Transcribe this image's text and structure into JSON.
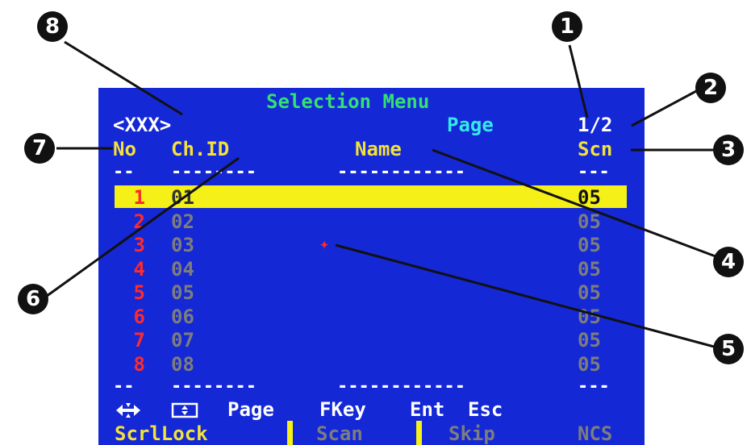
{
  "header": {
    "title": "Selection Menu",
    "group": "<XXX>",
    "page_label": "Page",
    "page_value": "1/2"
  },
  "columns": {
    "no": "No",
    "chid": "Ch.ID",
    "name": "Name",
    "scn": "Scn"
  },
  "dashes": {
    "no": "--",
    "chid": "--------",
    "name": "------------",
    "scn": "---"
  },
  "rows": [
    {
      "no": "1",
      "chid": "01",
      "scn": "05"
    },
    {
      "no": "2",
      "chid": "02",
      "scn": "05"
    },
    {
      "no": "3",
      "chid": "03",
      "scn": "05"
    },
    {
      "no": "4",
      "chid": "04",
      "scn": "05"
    },
    {
      "no": "5",
      "chid": "05",
      "scn": "05"
    },
    {
      "no": "6",
      "chid": "06",
      "scn": "05"
    },
    {
      "no": "7",
      "chid": "07",
      "scn": "05"
    },
    {
      "no": "8",
      "chid": "08",
      "scn": "05"
    }
  ],
  "selected_row_index": 0,
  "cursor_glyph": "✦",
  "footer_keys": [
    "Page",
    "FKey",
    "Ent",
    "Esc"
  ],
  "status_bar": [
    "ScrlLock",
    "Scan",
    "Skip",
    "NCS"
  ],
  "callouts": [
    "1",
    "2",
    "3",
    "4",
    "5",
    "6",
    "7",
    "8"
  ],
  "colors": {
    "background": "#1428d6",
    "title": "#34e070",
    "page": "#35e8e8",
    "highlight": "#f4f018",
    "row_number": "#ff2a2a",
    "inactive_text": "#7d7d7d"
  }
}
